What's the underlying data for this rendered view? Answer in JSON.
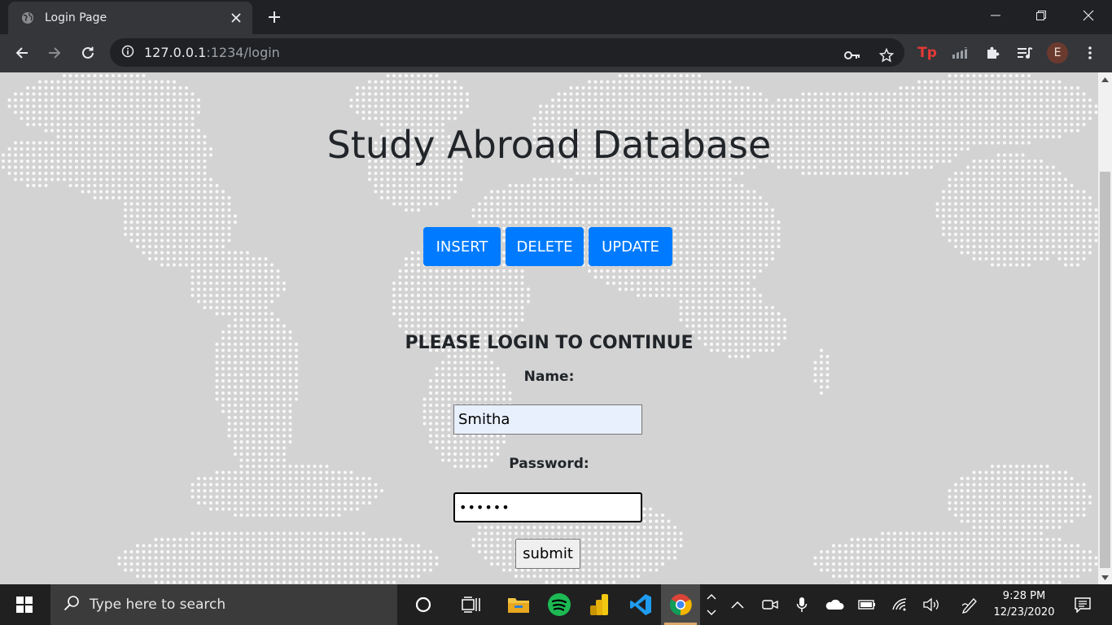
{
  "browser": {
    "tab_title": "Login Page",
    "url_host": "127.0.0.1",
    "url_rest": ":1234/login",
    "avatar_letter": "E"
  },
  "page": {
    "title": "Study Abroad Database",
    "buttons": {
      "insert": "INSERT",
      "delete": "DELETE",
      "update": "UPDATE"
    },
    "login_heading": "PLEASE LOGIN TO CONTINUE",
    "name_label": "Name:",
    "name_value": "Smitha",
    "password_label": "Password:",
    "password_value": "••••••",
    "submit_label": "submit",
    "colors": {
      "primary_button": "#007bff",
      "background": "#d3d3d3"
    }
  },
  "taskbar": {
    "search_placeholder": "Type here to search",
    "time": "9:28 PM",
    "date": "12/23/2020"
  }
}
